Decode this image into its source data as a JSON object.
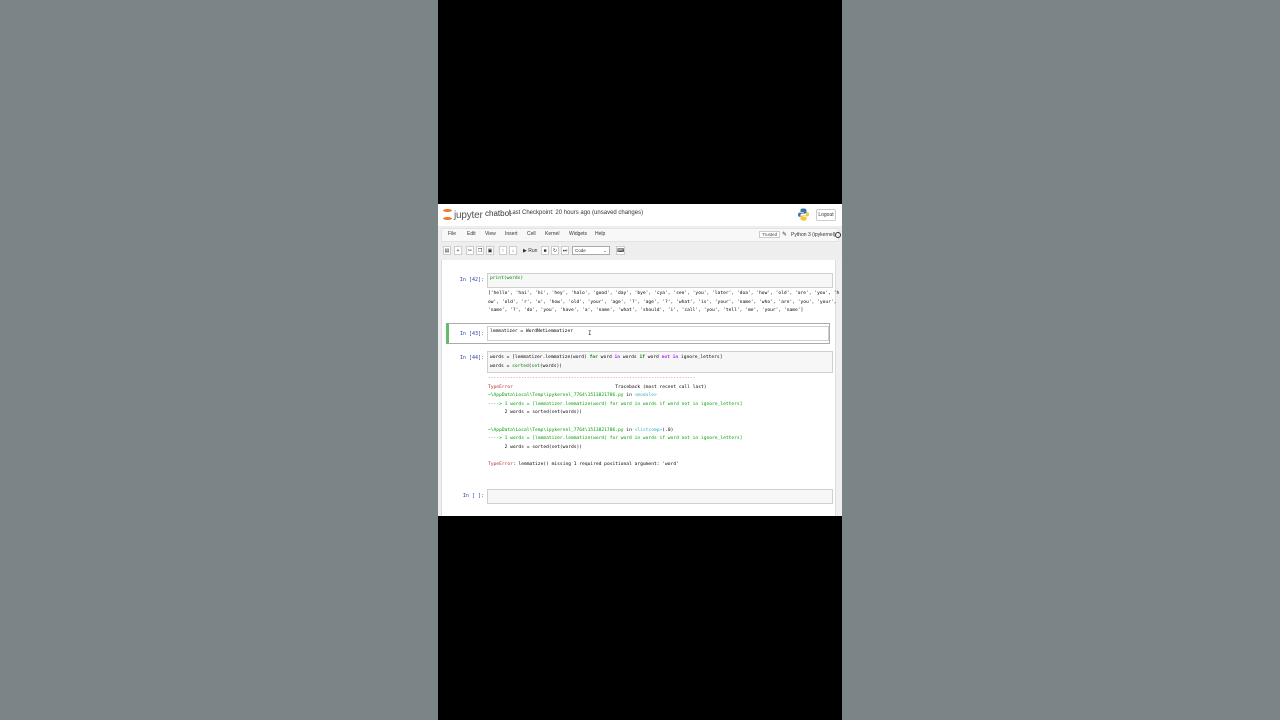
{
  "header": {
    "logo_text": "jupyter",
    "notebook_name": "chatbot",
    "checkpoint": "Last Checkpoint: 20 hours ago  (unsaved changes)",
    "logout": "Logout"
  },
  "menubar": {
    "items": [
      "File",
      "Edit",
      "View",
      "Insert",
      "Cell",
      "Kernel",
      "Widgets",
      "Help"
    ],
    "trusted": "Trusted",
    "kernel": "Python 3 (ipykernel)"
  },
  "toolbar": {
    "run_label": "Run",
    "cell_type": "Code"
  },
  "cells": {
    "c42": {
      "prompt": "In [42]:",
      "code": "print(words)",
      "output": "['hello', 'hai', 'hi', 'hey', 'halo', 'good', 'day', 'bye', 'cya', 'see', 'you', 'later', 'doa', 'how', 'old', 'are', 'you', 'h\now', 'old', 'r', 'u', 'how', 'old', 'your', 'age', '?', 'age', '?', 'what', 'is', 'your', 'name', 'who', 'are', 'you', 'your',\n'name', '?', 'do', 'you', 'have', 'a', 'name', 'what', 'should', 'i', 'call', 'you', 'tell', 'me', 'your', 'name']"
    },
    "c43": {
      "prompt": "In [43]:",
      "code": "lemmatizer = WordNetLemmatizer"
    },
    "c44": {
      "prompt": "In [44]:",
      "line1_a": "words ",
      "line1_b": "= [lemmatizer.lemmatize(word) ",
      "line1_c": "for",
      "line1_d": " word ",
      "line1_e": "in",
      "line1_f": " words ",
      "line1_g": "if",
      "line1_h": " word ",
      "line1_i": "not in",
      "line1_j": " ignore_letters]",
      "line2_a": "words ",
      "line2_b": "= ",
      "line2_c": "sorted",
      "line2_d": "(",
      "line2_e": "set",
      "line2_f": "(words))",
      "tb_dashes": "---------------------------------------------------------------------------",
      "tb_type": "TypeError",
      "tb_header": "Traceback (most recent call last)",
      "tb_path1": "~\\AppData\\Local\\Temp\\ipykernel_7764\\1513821786.py",
      "tb_in": " in ",
      "tb_mod1": "<module>",
      "tb_arrow1": "----> 1 words = [lemmatizer.lemmatize(word) for word in words if word not in ignore_letters]",
      "tb_line2a": "      2 words = sorted(set(words))",
      "tb_path2": "~\\AppData\\Local\\Temp\\ipykernel_7764\\1513821786.py",
      "tb_mod2": "<listcomp>",
      "tb_mod2b": "(.0)",
      "tb_arrow2": "----> 1 words = [lemmatizer.lemmatize(word) for word in words if word not in ignore_letters]",
      "tb_line2b": "      2 words = sorted(set(words))",
      "tb_err_type": "TypeError",
      "tb_err_msg": ": lemmatize() missing 1 required positional argument: 'word'"
    },
    "empty": {
      "prompt": "In [ ]:"
    }
  },
  "colors": {
    "jupyter_orange": "#f37726",
    "prompt_blue": "#303f9f",
    "selected_green": "#66bb6a",
    "error_red": "#b22b31"
  }
}
